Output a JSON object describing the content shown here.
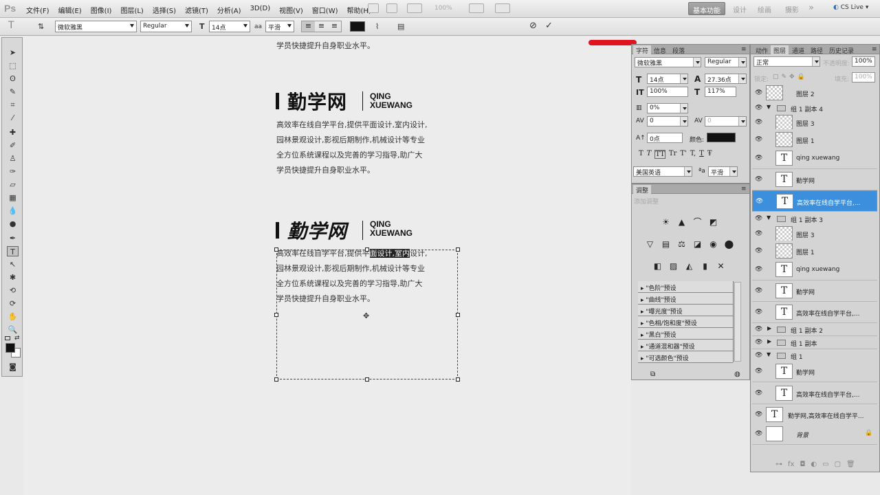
{
  "app": {
    "logo": "Ps"
  },
  "menu": [
    "文件(F)",
    "编辑(E)",
    "图像(I)",
    "图层(L)",
    "选择(S)",
    "滤镜(T)",
    "分析(A)",
    "3D(D)",
    "视图(V)",
    "窗口(W)",
    "帮助(H)"
  ],
  "topbar": {
    "zoom": "100%",
    "workspaces": [
      "基本功能",
      "设计",
      "绘画",
      "摄影"
    ],
    "more": "»",
    "cslive": "CS Live"
  },
  "options": {
    "font_family": "微软雅黑",
    "font_style": "Regular",
    "font_size": "14点",
    "aa_label": "aa",
    "antialias": "平滑"
  },
  "canvas": {
    "top_line": "学员快捷提升自身职业水平。",
    "logo1": "勤学网",
    "logo2": "勤学网",
    "logo_en1": "QING",
    "logo_en2": "XUEWANG",
    "para1": [
      "高效率在线自学平台,提供平面设计,室内设计,",
      "园林景观设计,影视后期制作,机械设计等专业",
      "全方位系统课程以及完善的学习指导,助广大",
      "学员快捷提升自身职业水平。"
    ],
    "para2_line1_a": "高效率在线自学平台,提供平",
    "para2_line1_hl": "面设计,室内",
    "para2_line1_b": "设计,",
    "para2": [
      "园林景观设计,影视后期制作,机械设计等专业",
      "全方位系统课程以及完善的学习指导,助广大",
      "学员快捷提升自身职业水平。"
    ]
  },
  "char_panel": {
    "tabs": [
      "字符",
      "信息",
      "段落"
    ],
    "font": "微软雅黑",
    "style": "Regular",
    "size": "14点",
    "leading": "27.36点",
    "vscale": "100%",
    "hscale": "117%",
    "tracking_ratio": "0%",
    "kerning": "0",
    "tracking": "0",
    "baseline": "0点",
    "color_label": "颜色:",
    "styles": [
      "T",
      "T",
      "TT",
      "Tr",
      "T'",
      "T,",
      "T",
      "Ŧ"
    ],
    "lang": "美国英语",
    "aa": "平滑"
  },
  "adj_panel": {
    "tab": "调整",
    "subtitle": "添加调整",
    "presets": [
      "\"色阶\"预设",
      "\"曲线\"预设",
      "\"曝光度\"预设",
      "\"色相/饱和度\"预设",
      "\"黑白\"预设",
      "\"通道混和器\"预设",
      "\"可选颜色\"预设"
    ]
  },
  "layers_panel": {
    "tabs": [
      "动作",
      "图层",
      "通道",
      "路径",
      "历史记录"
    ],
    "blend": "正常",
    "opacity_label": "不透明度:",
    "opacity": "100%",
    "lock_label": "锁定:",
    "fill_label": "填充:",
    "fill": "100%",
    "layers": [
      {
        "name": "图层 2",
        "kind": "raster"
      },
      {
        "name": "组 1 副本 4",
        "kind": "group"
      },
      {
        "name": "图层 3",
        "kind": "raster"
      },
      {
        "name": "图层 1",
        "kind": "raster"
      },
      {
        "name": "qing xuewang",
        "kind": "text"
      },
      {
        "name": "勤学网",
        "kind": "text"
      },
      {
        "name": "高效率在线自学平台,...",
        "kind": "text",
        "selected": true
      },
      {
        "name": "组 1 副本 3",
        "kind": "group"
      },
      {
        "name": "图层 3",
        "kind": "raster"
      },
      {
        "name": "图层 1",
        "kind": "raster"
      },
      {
        "name": "qing xuewang",
        "kind": "text"
      },
      {
        "name": "勤学网",
        "kind": "text"
      },
      {
        "name": "高效率在线自学平台,...",
        "kind": "text"
      },
      {
        "name": "组 1 副本 2",
        "kind": "group"
      },
      {
        "name": "组 1 副本",
        "kind": "group"
      },
      {
        "name": "组 1",
        "kind": "group"
      },
      {
        "name": "勤学网",
        "kind": "text"
      },
      {
        "name": "高效率在线自学平台,...",
        "kind": "text"
      },
      {
        "name": "勤学网,高效率在线自学平...",
        "kind": "text"
      },
      {
        "name": "背景",
        "kind": "background"
      }
    ]
  }
}
